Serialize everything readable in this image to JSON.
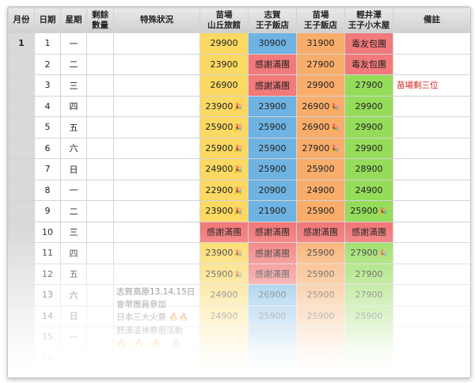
{
  "headers": {
    "month": "月份",
    "date": "日期",
    "weekday": "星期",
    "remaining_l1": "剩餘",
    "remaining_l2": "數量",
    "special": "特殊狀況",
    "h1_l1": "苗場",
    "h1_l2": "山丘旅館",
    "h2_l1": "志賀",
    "h2_l2": "王子飯店",
    "h3_l1": "苗場",
    "h3_l2": "王子飯店",
    "h4_l1": "輕井澤",
    "h4_l2": "王子小木屋",
    "notes": "備註"
  },
  "month_value": "1",
  "rows": [
    {
      "date": "1",
      "wd": "一",
      "c1": "29900",
      "c2": "30900",
      "c3": "31900",
      "c4": "毒友包團",
      "note": ""
    },
    {
      "date": "2",
      "wd": "二",
      "c1": "23900",
      "c2": "感謝滿團",
      "c3": "27900",
      "c4": "毒友包團",
      "note": ""
    },
    {
      "date": "3",
      "wd": "三",
      "c1": "26900",
      "c2": "感謝滿團",
      "c3": "29900",
      "c4": "27900",
      "note": "苗場剩三位"
    },
    {
      "date": "4",
      "wd": "四",
      "c1": "23900",
      "c2": "23900",
      "c3": "26900",
      "c4": "29900",
      "note": ""
    },
    {
      "date": "5",
      "wd": "五",
      "c1": "25900",
      "c2": "25900",
      "c3": "26900",
      "c4": "29900",
      "note": ""
    },
    {
      "date": "6",
      "wd": "六",
      "c1": "25900",
      "c2": "25900",
      "c3": "27900",
      "c4": "29900",
      "note": ""
    },
    {
      "date": "7",
      "wd": "日",
      "c1": "24900",
      "c2": "25900",
      "c3": "25900",
      "c4": "28900",
      "note": ""
    },
    {
      "date": "8",
      "wd": "一",
      "c1": "22900",
      "c2": "20900",
      "c3": "24900",
      "c4": "24900",
      "note": ""
    },
    {
      "date": "9",
      "wd": "二",
      "c1": "23900",
      "c2": "21900",
      "c3": "25900",
      "c4": "25900",
      "note": ""
    },
    {
      "date": "10",
      "wd": "三",
      "c1": "感謝滿團",
      "c2": "感謝滿團",
      "c3": "感謝滿團",
      "c4": "感謝滿團",
      "note": ""
    },
    {
      "date": "11",
      "wd": "四",
      "c1": "23900",
      "c2": "感謝滿團",
      "c3": "25900",
      "c4": "27900",
      "note": ""
    },
    {
      "date": "12",
      "wd": "五",
      "c1": "25900",
      "c2": "感謝滿團",
      "c3": "25900",
      "c4": "27900",
      "note": ""
    },
    {
      "date": "13",
      "wd": "六",
      "c1": "24900",
      "c2": "26900",
      "c3": "25900",
      "c4": "27900",
      "note": ""
    },
    {
      "date": "14",
      "wd": "日",
      "c1": "24900",
      "c2": "25900",
      "c3": "25900",
      "c4": "25900",
      "note": ""
    },
    {
      "date": "15",
      "wd": "一",
      "c1": "",
      "c2": "",
      "c3": "",
      "c4": "",
      "note": ""
    },
    {
      "date": "16",
      "wd": "二",
      "c1": "",
      "c2": "",
      "c3": "",
      "c4": "",
      "note": ""
    }
  ],
  "special_note": {
    "line1": "志賀高原13,14,15日",
    "line2": "會帶團員參加",
    "line3": "日本三大火祭",
    "line4": "野澤道神祭祖活動"
  },
  "icons": {
    "confetti": "party-popper-icon",
    "flame": "flame-icon"
  },
  "colors": {
    "yellow": "#fbd962",
    "blue": "#6fb3e2",
    "orange": "#f9ad6b",
    "green": "#95dc5b",
    "red": "#f27a7a",
    "note_red": "#d8231a"
  }
}
